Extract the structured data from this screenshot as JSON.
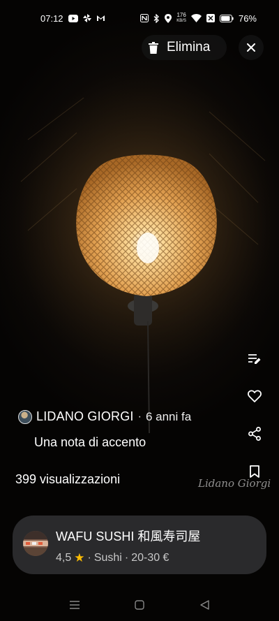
{
  "status_bar": {
    "time": "07:12",
    "battery": "76%",
    "net_speed_top": "176",
    "net_speed_unit": "KB/S",
    "left_icons": [
      "youtube-icon",
      "pinwheel-icon",
      "gmail-icon"
    ],
    "right_icons": [
      "nfc-icon",
      "bluetooth-icon",
      "location-icon",
      "wifi-icon",
      "sim-off-icon",
      "battery-icon"
    ]
  },
  "top_actions": {
    "delete_label": "Elimina"
  },
  "side_actions": [
    "edit-note-icon",
    "heart-icon",
    "share-icon",
    "bookmark-icon"
  ],
  "post": {
    "author": "LIDANO GIORGI",
    "separator": "·",
    "time_ago": "6 anni fa",
    "note": "Una nota di accento",
    "views": "399 visualizzazioni",
    "watermark": "Lidano Giorgi"
  },
  "place": {
    "name": "WAFU SUSHI 和風寿司屋",
    "rating": "4,5",
    "category": "Sushi",
    "price_range": "20-30 €",
    "meta_separator": "·"
  },
  "colors": {
    "card_bg": "#2a2a2c",
    "star": "#fbbc04",
    "lamp_glow": "#f4c27a"
  }
}
